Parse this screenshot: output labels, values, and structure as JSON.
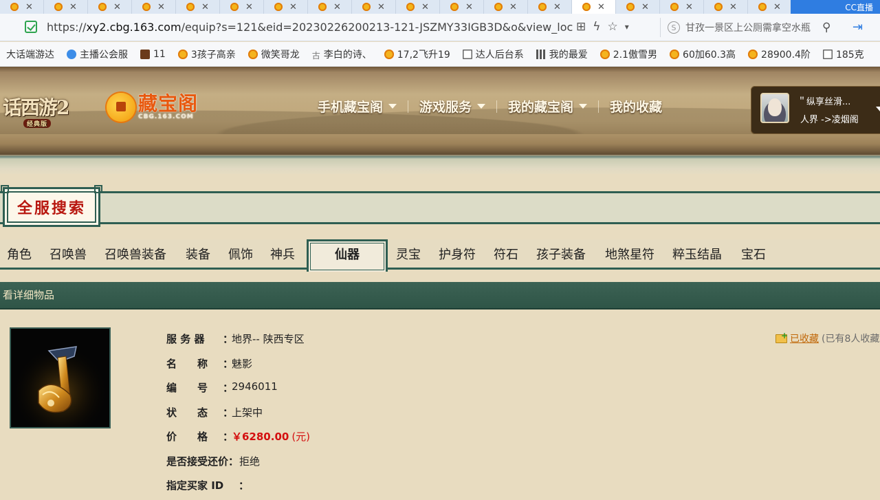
{
  "browser": {
    "tab_count": 18,
    "tab_close_glyph": "✕",
    "corner_badge": "CC直播",
    "url_scheme": "https://",
    "url_host": "xy2.cbg.163.com",
    "url_rest": "/equip?s=121&eid=20230226200213-121-JSZMY33IGB3D&o&view_loc=",
    "search_text": "甘孜一景区上公厕需拿空水瓶",
    "search_engine_glyph": "S"
  },
  "bookmarks": [
    {
      "label": "大话端游达",
      "icon": "none"
    },
    {
      "label": "主播公会服",
      "icon": "blue"
    },
    {
      "label": "11",
      "icon": "dark"
    },
    {
      "label": "3孩子高亲",
      "icon": "coin"
    },
    {
      "label": "微笑哥龙",
      "icon": "coin"
    },
    {
      "label": "李白的诗、",
      "icon": "gu"
    },
    {
      "label": "17,2飞升19",
      "icon": "coin"
    },
    {
      "label": "达人后台系",
      "icon": "doc"
    },
    {
      "label": "我的最爱",
      "icon": "grid"
    },
    {
      "label": "2.1傲雪男",
      "icon": "coin"
    },
    {
      "label": "60加60.3高",
      "icon": "coin"
    },
    {
      "label": "28900.4阶",
      "icon": "coin"
    },
    {
      "label": "185克",
      "icon": "doc"
    }
  ],
  "site": {
    "game_logo": "话西游2",
    "game_logo_sub": "经典版",
    "cbg_logo": "藏宝阁",
    "cbg_logo_sub": "CBG.163.COM",
    "nav": [
      {
        "label": "手机藏宝阁",
        "dropdown": true
      },
      {
        "label": "游戏服务",
        "dropdown": true
      },
      {
        "label": "我的藏宝阁",
        "dropdown": true
      },
      {
        "label": "我的收藏",
        "dropdown": false
      }
    ],
    "user_name": "＂纵享丝滑...",
    "user_location": "人界 ->凌烟阁"
  },
  "search": {
    "title": "全服搜索",
    "tabs": [
      "角色",
      "召唤兽",
      "召唤兽装备",
      "装备",
      "佩饰",
      "神兵",
      "仙器",
      "灵宝",
      "护身符",
      "符石",
      "孩子装备",
      "地煞星符",
      "粹玉结晶",
      "宝石"
    ],
    "active_tab": "仙器"
  },
  "section_title": "看详细物品",
  "item": {
    "fields": [
      {
        "label": "服 务 器",
        "value": "地界-- 陕西专区"
      },
      {
        "label": "名　　称",
        "value": "魅影"
      },
      {
        "label": "编　　号",
        "value": "2946011"
      },
      {
        "label": "状　　态",
        "value": "上架中"
      },
      {
        "label": "价　　格",
        "value": "￥6280.00",
        "suffix": "(元)"
      },
      {
        "label": "是否接受还价",
        "value": "拒绝"
      },
      {
        "label": "指定买家 ID",
        "value": ""
      }
    ],
    "favorite_label": "已收藏",
    "favorite_count": "(已有8人收藏"
  },
  "colors": {
    "accent_green": "#2e5e52",
    "price_red": "#d40f0f",
    "title_red": "#b8170f",
    "cbg_orange": "#e8590f"
  }
}
